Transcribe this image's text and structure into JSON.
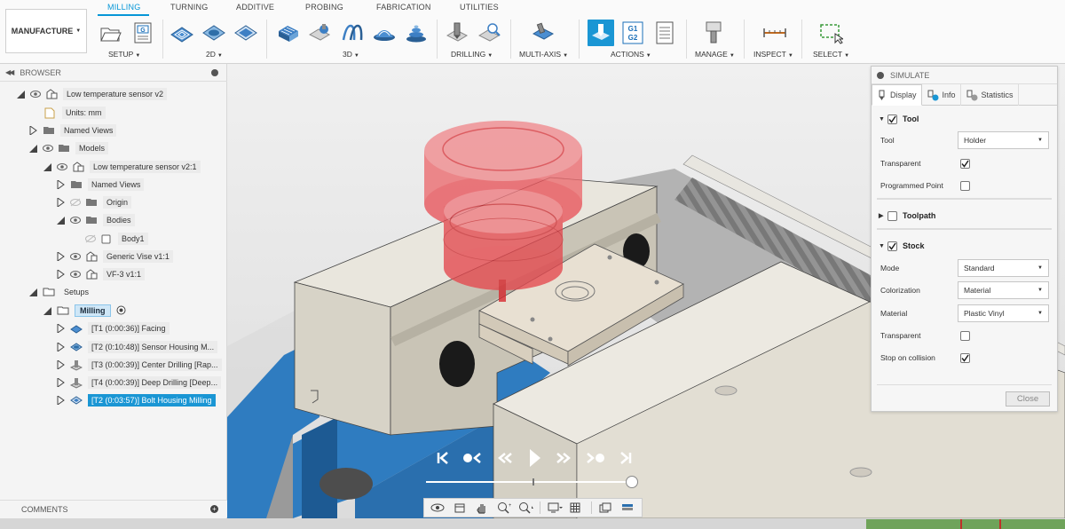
{
  "toolbar": {
    "workspace": "MANUFACTURE",
    "tabs": [
      "MILLING",
      "TURNING",
      "ADDITIVE",
      "PROBING",
      "FABRICATION",
      "UTILITIES"
    ],
    "groups": [
      "SETUP",
      "2D",
      "3D",
      "DRILLING",
      "MULTI-AXIS",
      "ACTIONS",
      "MANAGE",
      "INSPECT",
      "SELECT"
    ],
    "g1g2_icon_text": "G1 G2",
    "setup_icon_text": "G"
  },
  "browser": {
    "title": "BROWSER",
    "rows": [
      {
        "label": "Low temperature sensor v2"
      },
      {
        "label": "Units: mm"
      },
      {
        "label": "Named Views"
      },
      {
        "label": "Models"
      },
      {
        "label": "Low temperature sensor v2:1"
      },
      {
        "label": "Named Views"
      },
      {
        "label": "Origin"
      },
      {
        "label": "Bodies"
      },
      {
        "label": "Body1"
      },
      {
        "label": "Generic Vise v1:1"
      },
      {
        "label": "VF-3 v1:1"
      },
      {
        "label": "Setups"
      },
      {
        "label": "Milling"
      },
      {
        "label": "[T1 (0:00:36)] Facing"
      },
      {
        "label": "[T2 (0:10:48)] Sensor Housing M..."
      },
      {
        "label": "[T3 (0:00:39)] Center Drilling [Rap..."
      },
      {
        "label": "[T4 (0:00:39)] Deep Drilling [Deep..."
      },
      {
        "label": "[T2 (0:03:57)] Bolt Housing Milling"
      }
    ],
    "comments": "COMMENTS"
  },
  "simulate": {
    "title": "SIMULATE",
    "tabs": [
      "Display",
      "Info",
      "Statistics"
    ],
    "tool_section": {
      "title": "Tool",
      "checked": true,
      "tool_label": "Tool",
      "tool_value": "Holder",
      "transparent_label": "Transparent",
      "transparent_checked": true,
      "programmed_point_label": "Programmed Point",
      "programmed_point_checked": false
    },
    "toolpath_section": {
      "title": "Toolpath",
      "checked": false
    },
    "stock_section": {
      "title": "Stock",
      "checked": true,
      "mode_label": "Mode",
      "mode_value": "Standard",
      "colorization_label": "Colorization",
      "colorization_value": "Material",
      "material_label": "Material",
      "material_value": "Plastic Vinyl",
      "transparent_label": "Transparent",
      "transparent_checked": false,
      "stop_label": "Stop on collision",
      "stop_checked": true
    },
    "close_label": "Close"
  },
  "colors": {
    "accent": "#0696d7",
    "selection": "#1a96d4",
    "vise_blue": "#2f7cc0",
    "tool_red": "#e8424a",
    "stock": "#e8e0d2"
  }
}
